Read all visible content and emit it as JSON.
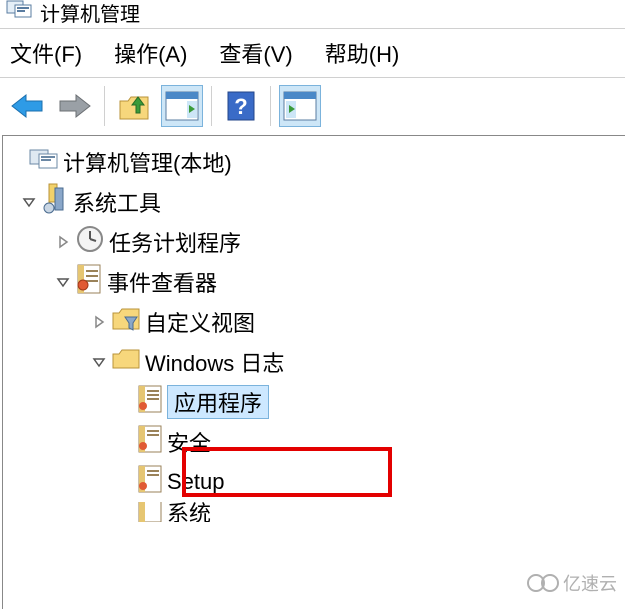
{
  "window": {
    "title": "计算机管理"
  },
  "menubar": {
    "file": "文件(F)",
    "action": "操作(A)",
    "view": "查看(V)",
    "help": "帮助(H)"
  },
  "toolbar_icons": {
    "back": "back-arrow",
    "forward": "forward-arrow",
    "up": "up-folder",
    "properties": "properties-pane",
    "help": "help",
    "run": "run-pane"
  },
  "tree": {
    "root": "计算机管理(本地)",
    "system_tools": "系统工具",
    "task_scheduler": "任务计划程序",
    "event_viewer": "事件查看器",
    "custom_views": "自定义视图",
    "windows_logs": "Windows 日志",
    "application": "应用程序",
    "security": "安全",
    "setup": "Setup",
    "system_partial": "系统"
  },
  "watermark": "亿速云"
}
